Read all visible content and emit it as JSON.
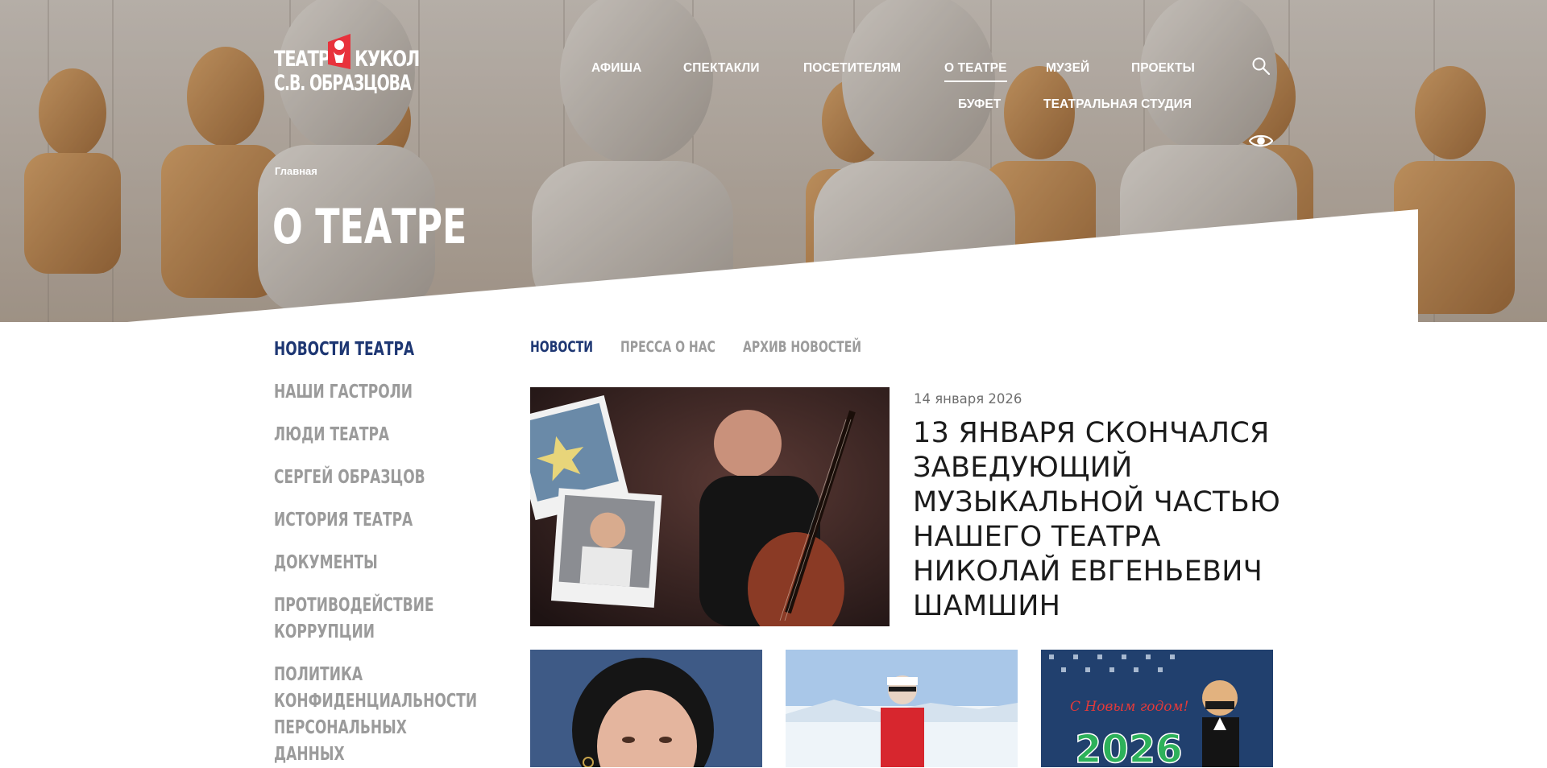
{
  "header": {
    "logo": {
      "line1_left": "ТЕАТР",
      "line1_right": "КУКОЛ",
      "line2": "С.В. ОБРАЗЦОВА"
    },
    "nav_row1": [
      "АФИША",
      "СПЕКТАКЛИ",
      "ПОСЕТИТЕЛЯМ",
      "О ТЕАТРЕ",
      "МУЗЕЙ",
      "ПРОЕКТЫ"
    ],
    "nav_row2": [
      "БУФЕТ",
      "ТЕАТРАЛЬНАЯ СТУДИЯ"
    ],
    "active_nav": "О ТЕАТРЕ",
    "icons": {
      "search": "search-icon",
      "accessibility": "eye-icon"
    }
  },
  "hero": {
    "breadcrumb": "Главная",
    "title": "О ТЕАТРЕ"
  },
  "sidebar": {
    "items": [
      "НОВОСТИ ТЕАТРА",
      "НАШИ ГАСТРОЛИ",
      "ЛЮДИ ТЕАТРА",
      "СЕРГЕЙ ОБРАЗЦОВ",
      "ИСТОРИЯ ТЕАТРА",
      "ДОКУМЕНТЫ",
      "ПРОТИВОДЕЙСТВИЕ",
      "КОРРУПЦИИ",
      "ПОЛИТИКА",
      "КОНФИДЕНЦИАЛЬНОСТИ",
      "ПЕРСОНАЛЬНЫХ",
      "ДАННЫХ"
    ],
    "active": "НОВОСТИ ТЕАТРА"
  },
  "tabs": {
    "items": [
      "НОВОСТИ",
      "ПРЕССА О НАС",
      "АРХИВ НОВОСТЕЙ"
    ],
    "active": "НОВОСТИ"
  },
  "featured": {
    "date": "14 января 2026",
    "title": "13 января скончался заведующий музыкальной частью нашего театра Николай Евгеньевич Шамшин"
  },
  "cards": {
    "card3_caption": "С Новым годом!",
    "card3_number": "2026"
  },
  "colors": {
    "accent_navy": "#1e3773",
    "muted_gray": "#9b9b9b",
    "logo_red": "#e8323c"
  }
}
